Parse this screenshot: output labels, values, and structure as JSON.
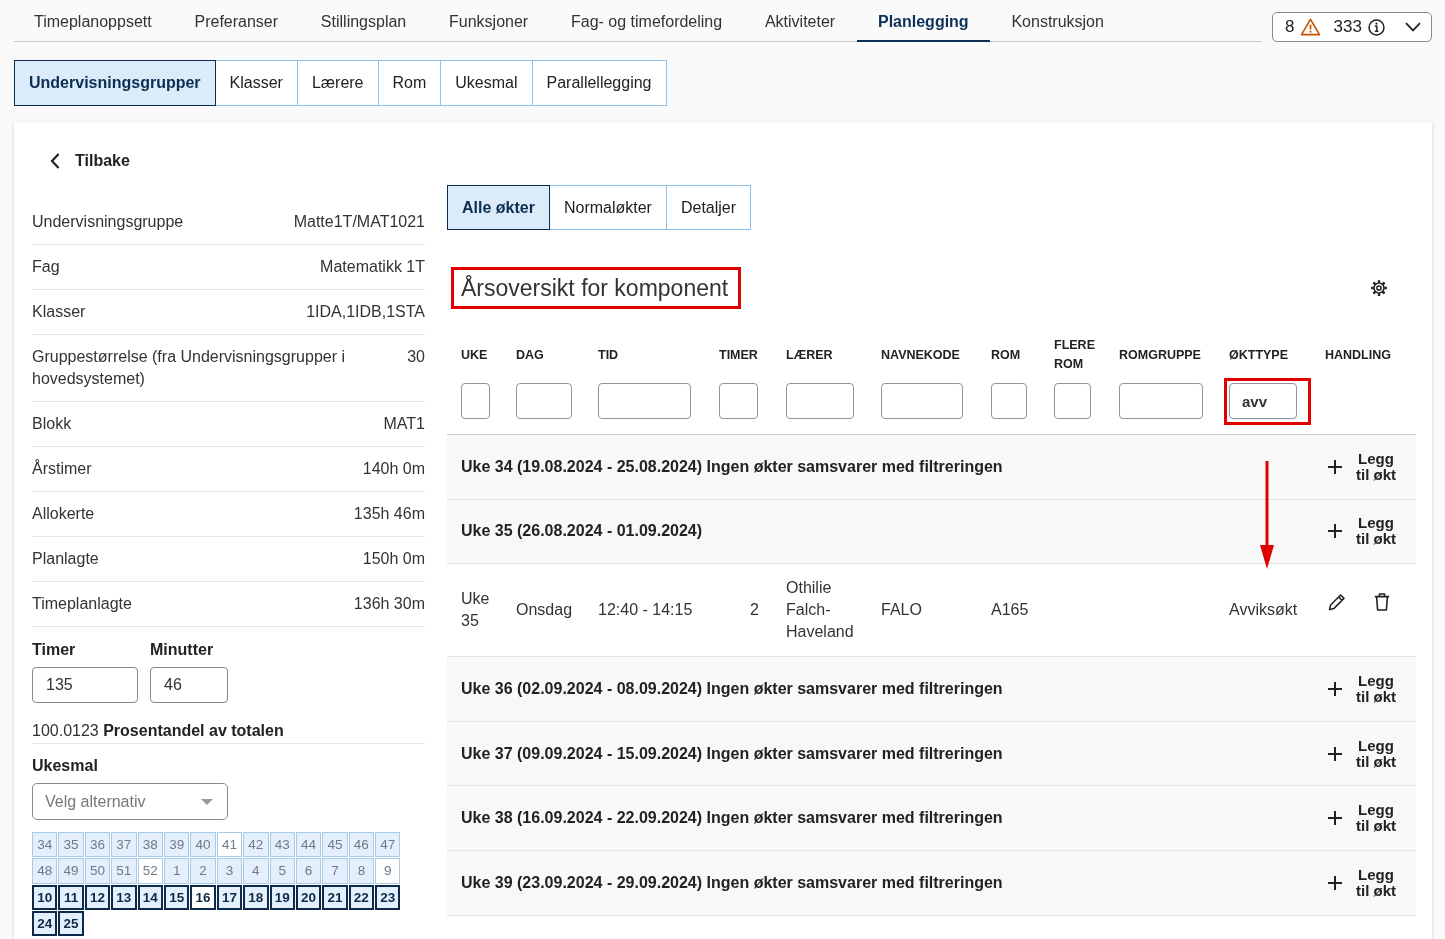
{
  "top_nav": {
    "tabs": [
      {
        "label": "Timeplanoppsett",
        "selected": false
      },
      {
        "label": "Preferanser",
        "selected": false
      },
      {
        "label": "Stillingsplan",
        "selected": false
      },
      {
        "label": "Funksjoner",
        "selected": false
      },
      {
        "label": "Fag- og timefordeling",
        "selected": false
      },
      {
        "label": "Aktiviteter",
        "selected": false
      },
      {
        "label": "Planlegging",
        "selected": true
      },
      {
        "label": "Konstruksjon",
        "selected": false
      }
    ],
    "notices": [
      {
        "kind": "warning",
        "count": "8"
      },
      {
        "kind": "info",
        "count": "333"
      }
    ]
  },
  "sub_tabs": [
    {
      "label": "Undervisningsgrupper",
      "selected": true
    },
    {
      "label": "Klasser",
      "selected": false
    },
    {
      "label": "Lærere",
      "selected": false
    },
    {
      "label": "Rom",
      "selected": false
    },
    {
      "label": "Ukesmal",
      "selected": false
    },
    {
      "label": "Parallellegging",
      "selected": false
    }
  ],
  "back_link": "Tilbake",
  "details": [
    {
      "label": "Undervisningsgruppe",
      "value": "Matte1T/MAT1021"
    },
    {
      "label": "Fag",
      "value": "Matematikk 1T"
    },
    {
      "label": "Klasser",
      "value": "1IDA,1IDB,1STA"
    },
    {
      "label": "Gruppestørrelse (fra Undervisningsgrupper i hovedsystemet)",
      "value": "30"
    },
    {
      "label": "Blokk",
      "value": "MAT1"
    },
    {
      "label": "Årstimer",
      "value": "140h 0m"
    },
    {
      "label": "Allokerte",
      "value": "135h 46m"
    },
    {
      "label": "Planlagte",
      "value": "150h 0m"
    },
    {
      "label": "Timeplanlagte",
      "value": "136h 30m"
    }
  ],
  "time_fields": [
    {
      "label": "Timer",
      "value": "135"
    },
    {
      "label": "Minutter",
      "value": "46"
    }
  ],
  "share": "100.0123 **Prosentandel av totalen**",
  "week_template": {
    "label": "Ukesmal",
    "placeholder": "Velg alternativ",
    "weeks": [
      {
        "label": "34",
        "selected": false,
        "filled": true
      },
      {
        "label": "35",
        "selected": false,
        "filled": true
      },
      {
        "label": "36",
        "selected": false,
        "filled": true
      },
      {
        "label": "37",
        "selected": false,
        "filled": true
      },
      {
        "label": "38",
        "selected": false,
        "filled": true
      },
      {
        "label": "39",
        "selected": false,
        "filled": true
      },
      {
        "label": "40",
        "selected": false,
        "filled": true
      },
      {
        "label": "41",
        "selected": false,
        "filled": false
      },
      {
        "label": "42",
        "selected": false,
        "filled": true
      },
      {
        "label": "43",
        "selected": false,
        "filled": true
      },
      {
        "label": "44",
        "selected": false,
        "filled": true
      },
      {
        "label": "45",
        "selected": false,
        "filled": true
      },
      {
        "label": "46",
        "selected": false,
        "filled": true
      },
      {
        "label": "47",
        "selected": false,
        "filled": true
      },
      {
        "label": "48",
        "selected": false,
        "filled": true
      },
      {
        "label": "49",
        "selected": false,
        "filled": true
      },
      {
        "label": "50",
        "selected": false,
        "filled": true
      },
      {
        "label": "51",
        "selected": false,
        "filled": true
      },
      {
        "label": "52",
        "selected": false,
        "filled": false
      },
      {
        "label": "1",
        "selected": false,
        "filled": true
      },
      {
        "label": "2",
        "selected": false,
        "filled": true
      },
      {
        "label": "3",
        "selected": false,
        "filled": true
      },
      {
        "label": "4",
        "selected": false,
        "filled": true
      },
      {
        "label": "5",
        "selected": false,
        "filled": true
      },
      {
        "label": "6",
        "selected": false,
        "filled": true
      },
      {
        "label": "7",
        "selected": false,
        "filled": true
      },
      {
        "label": "8",
        "selected": false,
        "filled": true
      },
      {
        "label": "9",
        "selected": false,
        "filled": false
      },
      {
        "label": "10",
        "selected": true,
        "filled": true
      },
      {
        "label": "11",
        "selected": true,
        "filled": true
      },
      {
        "label": "12",
        "selected": true,
        "filled": true
      },
      {
        "label": "13",
        "selected": true,
        "filled": true
      },
      {
        "label": "14",
        "selected": true,
        "filled": true
      },
      {
        "label": "15",
        "selected": true,
        "filled": true
      },
      {
        "label": "16",
        "selected": true,
        "filled": false
      },
      {
        "label": "17",
        "selected": true,
        "filled": true
      },
      {
        "label": "18",
        "selected": true,
        "filled": true
      },
      {
        "label": "19",
        "selected": true,
        "filled": true
      },
      {
        "label": "20",
        "selected": true,
        "filled": true
      },
      {
        "label": "21",
        "selected": true,
        "filled": true
      },
      {
        "label": "22",
        "selected": true,
        "filled": true
      },
      {
        "label": "23",
        "selected": true,
        "filled": true
      },
      {
        "label": "24",
        "selected": true,
        "filled": true
      },
      {
        "label": "25",
        "selected": true,
        "filled": true
      }
    ]
  },
  "view_tabs": [
    {
      "label": "Alle økter",
      "selected": true
    },
    {
      "label": "Normaløkter",
      "selected": false
    },
    {
      "label": "Detaljer",
      "selected": false
    }
  ],
  "overview": {
    "title": "Årsoversikt for komponent",
    "highlighted": true,
    "columns": [
      {
        "label": "UKE",
        "filterable": true,
        "highlighted": false
      },
      {
        "label": "DAG",
        "filterable": true,
        "highlighted": false
      },
      {
        "label": "TID",
        "filterable": true,
        "highlighted": false
      },
      {
        "label": "TIMER",
        "filterable": true,
        "highlighted": false
      },
      {
        "label": "LÆRER",
        "filterable": true,
        "highlighted": false
      },
      {
        "label": "NAVNEKODE",
        "filterable": true,
        "highlighted": false
      },
      {
        "label": "ROM",
        "filterable": true,
        "highlighted": false
      },
      {
        "label": "FLERE ROM",
        "filterable": true,
        "highlighted": false
      },
      {
        "label": "ROMGRUPPE",
        "filterable": true,
        "highlighted": false
      },
      {
        "label": "ØKTTYPE",
        "filterable": true,
        "filter_value": "avv",
        "highlighted": true
      },
      {
        "label": "HANDLING",
        "filterable": false,
        "highlighted": false
      }
    ],
    "weeks": [
      {
        "title": "Uke 34 (19.08.2024 - 25.08.2024) Ingen økter samsvarer med filtreringen",
        "action": "Legg til økt"
      },
      {
        "title": "Uke 35 (26.08.2024 - 01.09.2024)",
        "action": "Legg til økt",
        "sessions": [
          {
            "week": "Uke 35",
            "day": "Onsdag",
            "time": "12:40 - 14:15",
            "hours": "2",
            "teacher": "Othilie Falch-Haveland",
            "name_code": "FALO",
            "room": "A165",
            "session_type": "Avviksøkt",
            "pointed": true
          }
        ]
      },
      {
        "title": "Uke 36 (02.09.2024 - 08.09.2024) Ingen økter samsvarer med filtreringen",
        "action": "Legg til økt"
      },
      {
        "title": "Uke 37 (09.09.2024 - 15.09.2024) Ingen økter samsvarer med filtreringen",
        "action": "Legg til økt"
      },
      {
        "title": "Uke 38 (16.09.2024 - 22.09.2024) Ingen økter samsvarer med filtreringen",
        "action": "Legg til økt"
      },
      {
        "title": "Uke 39 (23.09.2024 - 29.09.2024) Ingen økter samsvarer med filtreringen",
        "action": "Legg til økt"
      }
    ]
  }
}
